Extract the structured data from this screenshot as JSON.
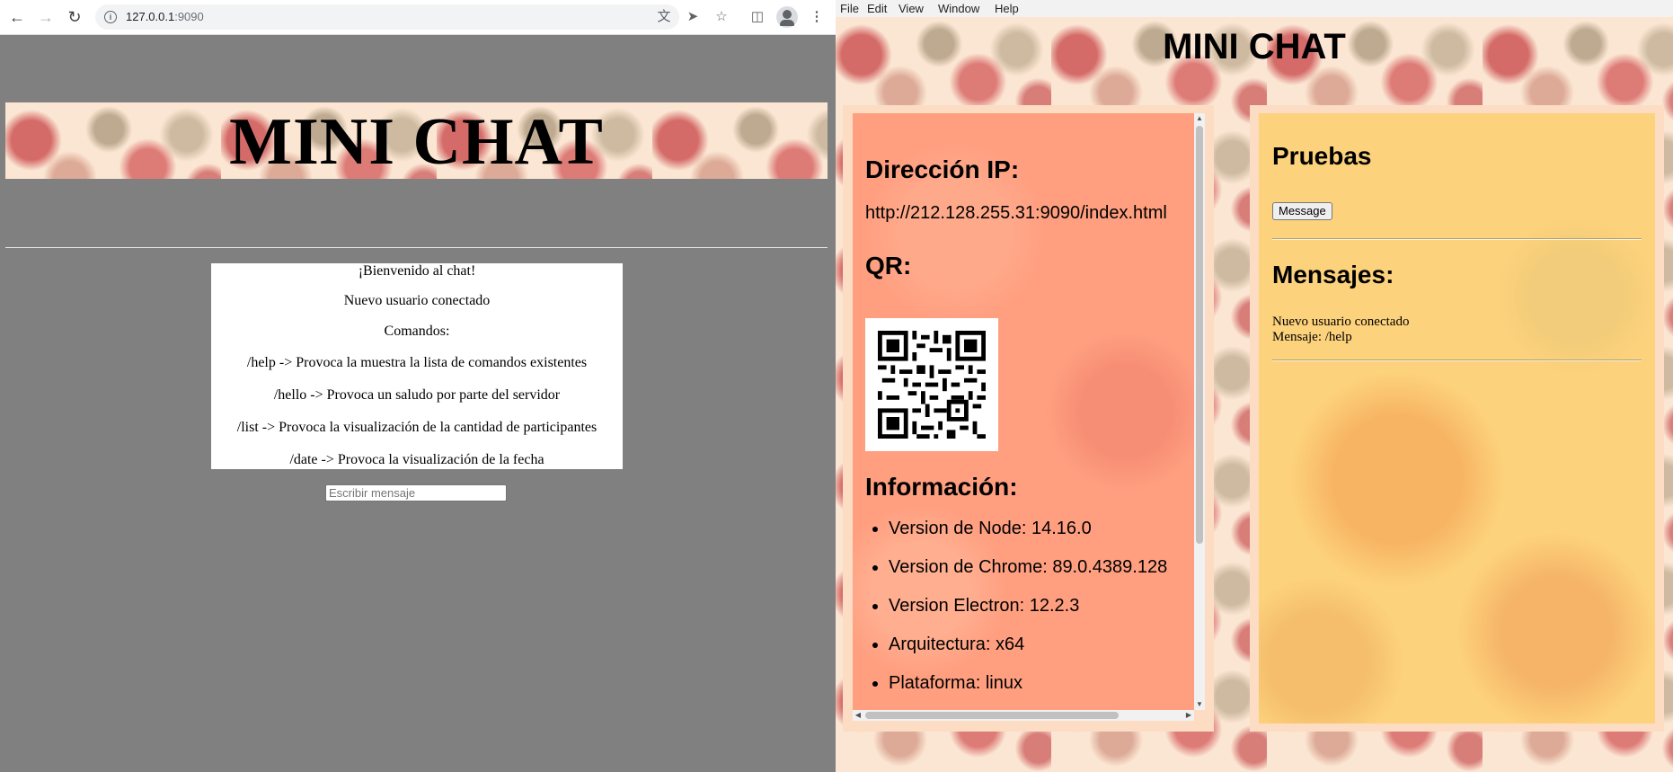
{
  "browser": {
    "url_host": "127.0.0.1",
    "url_port": ":9090",
    "page": {
      "title": "MINI CHAT",
      "chat_lines": [
        "¡Bienvenido al chat!",
        "Nuevo usuario conectado",
        "Comandos:",
        "/help -> Provoca la muestra la lista de comandos existentes",
        "/hello -> Provoca un saludo por parte del servidor",
        "/list -> Provoca la visualización de la cantidad de participantes",
        "/date -> Provoca la visualización de la fecha"
      ],
      "input_placeholder": "Escribir mensaje"
    }
  },
  "app": {
    "menu": [
      "File",
      "Edit",
      "View",
      "Window",
      "Help"
    ],
    "title": "MINI CHAT",
    "left_panel": {
      "ip_heading": "Dirección IP:",
      "ip_url": "http://212.128.255.31:9090/index.html",
      "qr_heading": "QR:",
      "info_heading": "Información:",
      "info_items": [
        "Version de Node: 14.16.0",
        "Version de Chrome: 89.0.4389.128",
        "Version Electron: 12.2.3",
        "Arquitectura: x64",
        "Plataforma: linux"
      ]
    },
    "right_panel": {
      "tests_heading": "Pruebas",
      "button_label": "Message",
      "messages_heading": "Mensajes:",
      "messages": [
        "Nuevo usuario conectado",
        "Mensaje: /help"
      ]
    }
  },
  "icons": [
    "back-arrow-icon",
    "forward-arrow-icon",
    "reload-icon",
    "info-icon",
    "translate-icon",
    "send-icon",
    "star-icon",
    "side-panel-icon",
    "profile-icon",
    "more-menu-icon"
  ]
}
